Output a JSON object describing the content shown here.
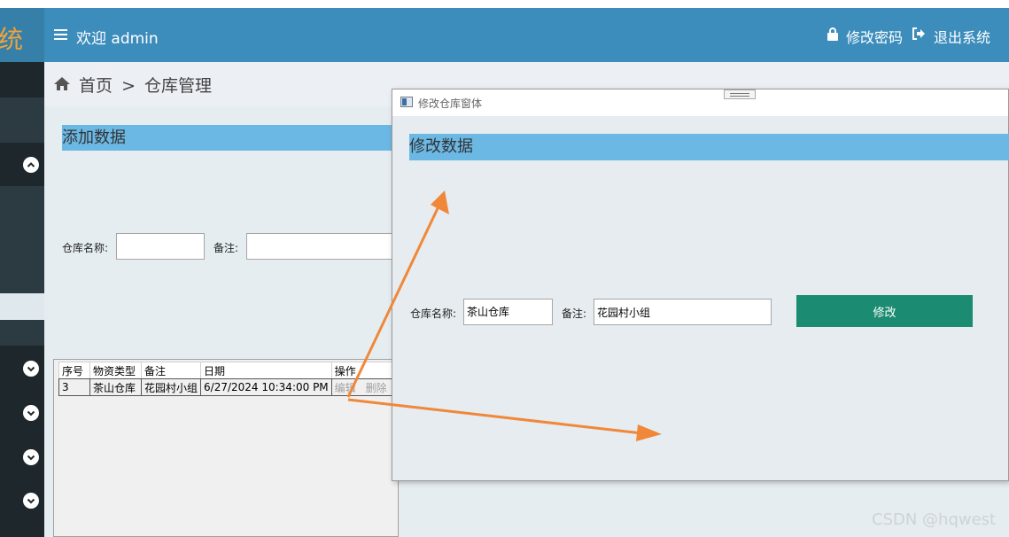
{
  "header": {
    "logo_text": "统",
    "welcome": "欢迎 admin",
    "change_password": "修改密码",
    "logout": "退出系统",
    "color": "#3c8dbc"
  },
  "breadcrumb": {
    "home": "首页",
    "separator": ">",
    "current": "仓库管理"
  },
  "add_form": {
    "title": "添加数据",
    "name_label": "仓库名称:",
    "name_value": "",
    "note_label": "备注:",
    "note_value": ""
  },
  "grid": {
    "columns": [
      "序号",
      "物资类型",
      "备注",
      "日期",
      "操作"
    ],
    "rows": [
      {
        "id": "3",
        "type": "茶山仓库",
        "note": "花园村小组",
        "date": "6/27/2024 10:34:00 PM",
        "edit": "编辑",
        "delete": "删除"
      }
    ]
  },
  "dialog": {
    "window_title": "修改仓库窗体",
    "section_title": "修改数据",
    "name_label": "仓库名称:",
    "name_value": "茶山仓库",
    "note_label": "备注:",
    "note_value": "花园村小组",
    "submit_label": "修改",
    "submit_color": "#1b8b72"
  },
  "sidebar": {
    "icons": [
      "chevron-up-icon",
      "chevron-down-icon",
      "chevron-down-icon",
      "chevron-down-icon",
      "chevron-down-icon"
    ]
  },
  "annotation_color": "#f0883a",
  "watermark": "CSDN @hqwest"
}
